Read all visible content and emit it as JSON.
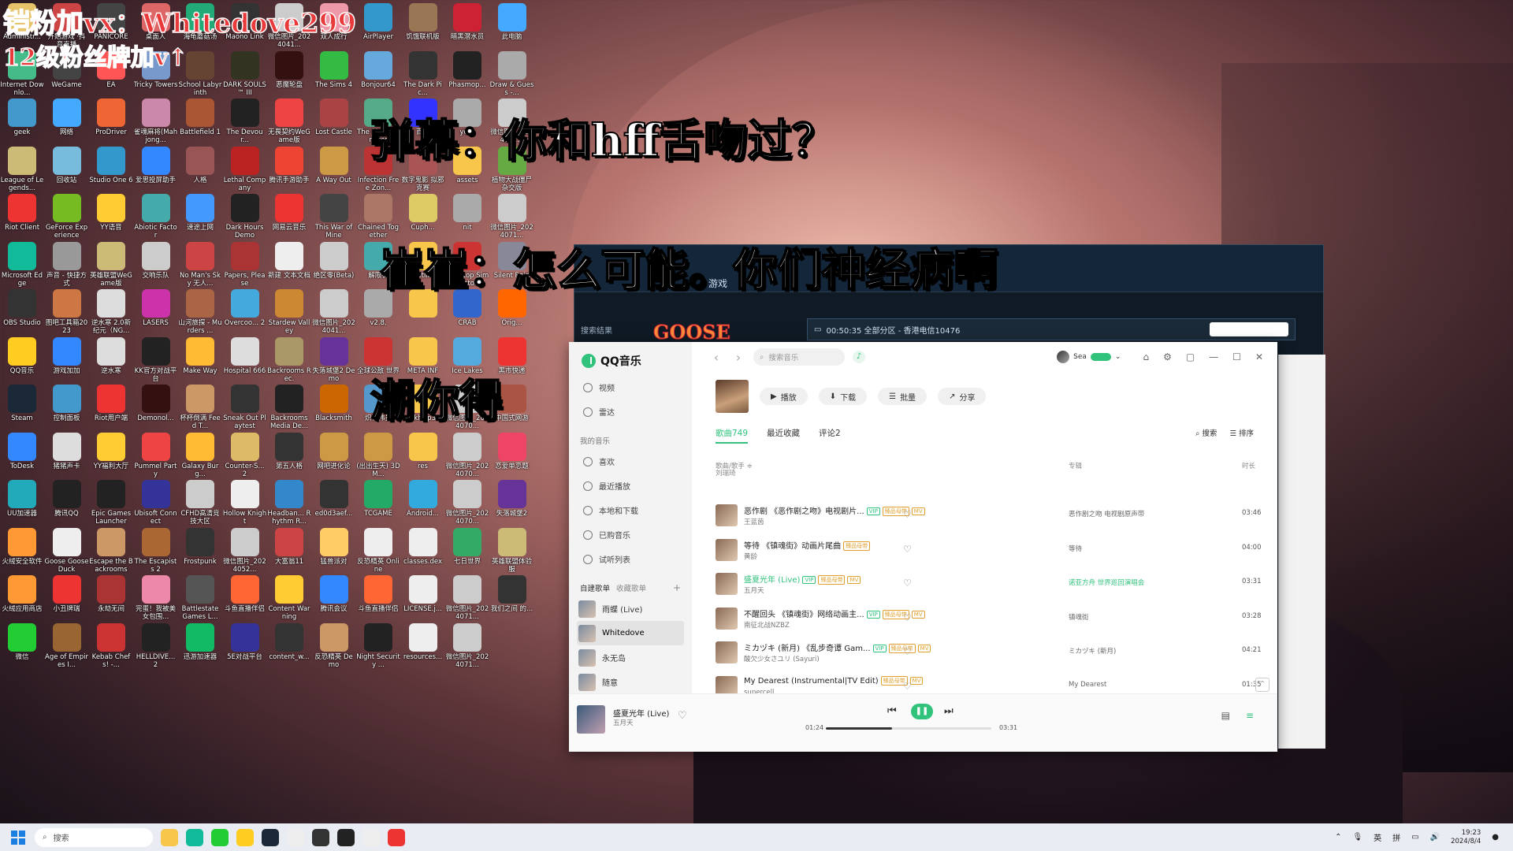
{
  "overlay": {
    "top_line1": "铠粉加vx：Whitedove299",
    "top_line2": "12级粉丝牌加v↑",
    "line_danmaku": "弹幕：你和hff舌吻过？",
    "line_reply": "崔崔：怎么可能。你们神经病啊",
    "line_tease": "潮你得"
  },
  "desktop_icons": [
    {
      "label": "Administr...",
      "color": "#e6c36a"
    },
    {
      "label": "开始游戏 ·抖音直播",
      "color": "#c44"
    },
    {
      "label": "PANICORE",
      "color": "#444"
    },
    {
      "label": "桌面人",
      "color": "#d66"
    },
    {
      "label": "海龟蘑菇汤",
      "color": "#2a7"
    },
    {
      "label": "Maono Link",
      "color": "#333"
    },
    {
      "label": "微信图片_2024041...",
      "color": "#ccc"
    },
    {
      "label": "双人成行",
      "color": "#e9a"
    },
    {
      "label": "AirPlayer",
      "color": "#39c"
    },
    {
      "label": "饥饿联机版",
      "color": "#975"
    },
    {
      "label": "暗黑潜水员",
      "color": "#c23"
    },
    {
      "label": "此电脑",
      "color": "#4af"
    },
    {
      "label": "Internet Downlo...",
      "color": "#4b8"
    },
    {
      "label": "WeGame",
      "color": "#444"
    },
    {
      "label": "EA",
      "color": "#f55"
    },
    {
      "label": "Tricky Towers",
      "color": "#79c"
    },
    {
      "label": "School Labyrinth",
      "color": "#643"
    },
    {
      "label": "DARK SOULS™ III",
      "color": "#332"
    },
    {
      "label": "恶魔轮盘",
      "color": "#311"
    },
    {
      "label": "The Sims 4",
      "color": "#3b4"
    },
    {
      "label": "Bonjour64",
      "color": "#6ad"
    },
    {
      "label": "The Dark Pic...",
      "color": "#333"
    },
    {
      "label": "Phasmop...",
      "color": "#222"
    },
    {
      "label": "Draw & Guess -...",
      "color": "#aaa"
    },
    {
      "label": "geek",
      "color": "#49c"
    },
    {
      "label": "网络",
      "color": "#4af"
    },
    {
      "label": "ProDriver",
      "color": "#e63"
    },
    {
      "label": "雀魂麻将(Mahjong...",
      "color": "#c8a"
    },
    {
      "label": "Battlefield 1",
      "color": "#a53"
    },
    {
      "label": "The Devour...",
      "color": "#222"
    },
    {
      "label": "无畏契约WeGame版",
      "color": "#e44"
    },
    {
      "label": "Lost Castle",
      "color": "#a44"
    },
    {
      "label": "The Planet Crafter",
      "color": "#5a8"
    },
    {
      "label": "百度",
      "color": "#33f"
    },
    {
      "label": "your",
      "color": "#aaa"
    },
    {
      "label": "微信图片_2024071...",
      "color": "#ccc"
    },
    {
      "label": "League of Legends...",
      "color": "#cb7"
    },
    {
      "label": "回收站",
      "color": "#7bd"
    },
    {
      "label": "Studio One 6",
      "color": "#39c"
    },
    {
      "label": "爱思投屏助手",
      "color": "#38f"
    },
    {
      "label": "人格",
      "color": "#955"
    },
    {
      "label": "Lethal Company",
      "color": "#b22"
    },
    {
      "label": "腾讯手游助手",
      "color": "#e43"
    },
    {
      "label": "A Way Out",
      "color": "#c94"
    },
    {
      "label": "Infection Free Zon...",
      "color": "#b33"
    },
    {
      "label": "数字鬼影 拟邪克赛",
      "color": "#a55"
    },
    {
      "label": "assets",
      "color": "#f7c64a"
    },
    {
      "label": "植物大战僵尸杂交版",
      "color": "#6a4"
    },
    {
      "label": "Riot Client",
      "color": "#e33"
    },
    {
      "label": "GeForce Experience",
      "color": "#7b2"
    },
    {
      "label": "YY语音",
      "color": "#fc3"
    },
    {
      "label": "Abiotic Factor",
      "color": "#4aa"
    },
    {
      "label": "速途上网",
      "color": "#49f"
    },
    {
      "label": "Dark Hours Demo",
      "color": "#222"
    },
    {
      "label": "网易云音乐",
      "color": "#e33"
    },
    {
      "label": "This War of Mine",
      "color": "#444"
    },
    {
      "label": "Chained Together",
      "color": "#a76"
    },
    {
      "label": "Cuph...",
      "color": "#dc6"
    },
    {
      "label": "nit",
      "color": "#aaa"
    },
    {
      "label": "微信图片_2024071...",
      "color": "#ccc"
    },
    {
      "label": "Microsoft Edge",
      "color": "#1b9"
    },
    {
      "label": "声音 - 快捷方式",
      "color": "#999"
    },
    {
      "label": "英雄联盟WeGame版",
      "color": "#cb7"
    },
    {
      "label": "交响乐队",
      "color": "#ccc"
    },
    {
      "label": "No Man's Sky 无人...",
      "color": "#c44"
    },
    {
      "label": "Papers, Please",
      "color": "#a33"
    },
    {
      "label": "新建 文本文档",
      "color": "#eee"
    },
    {
      "label": "绝区零(Beta)",
      "color": "#ccc"
    },
    {
      "label": "解限机",
      "color": "#4aa"
    },
    {
      "label": "kotlin",
      "color": "#f7c64a"
    },
    {
      "label": "Tabletop Simulator",
      "color": "#c33"
    },
    {
      "label": "Silent Rain",
      "color": "#889"
    },
    {
      "label": "OBS Studio",
      "color": "#333"
    },
    {
      "label": "图吧工具箱2023",
      "color": "#c74"
    },
    {
      "label": "逆水寒 2.0新纪元（NG...",
      "color": "#ddd"
    },
    {
      "label": "LASERS",
      "color": "#c3a"
    },
    {
      "label": "山河旅探 - Murders ...",
      "color": "#a64"
    },
    {
      "label": "Overcoo... 2",
      "color": "#4ad"
    },
    {
      "label": "Stardew Valley",
      "color": "#c83"
    },
    {
      "label": "微信图片_2024041...",
      "color": "#ccc"
    },
    {
      "label": "v2.8.",
      "color": "#aaa"
    },
    {
      "label": "",
      "color": "#f7c64a"
    },
    {
      "label": "CRAB",
      "color": "#36c"
    },
    {
      "label": "Orig...",
      "color": "#f60"
    },
    {
      "label": "QQ音乐",
      "color": "#fc2"
    },
    {
      "label": "游戏加加",
      "color": "#38f"
    },
    {
      "label": "逆水寒",
      "color": "#ddd"
    },
    {
      "label": "KK官方对战平台",
      "color": "#222"
    },
    {
      "label": "Make Way",
      "color": "#fb3"
    },
    {
      "label": "Hospital 666",
      "color": "#ddd"
    },
    {
      "label": "Backrooms Rec.",
      "color": "#a96"
    },
    {
      "label": "失落城堡2 Demo",
      "color": "#639"
    },
    {
      "label": "全球公敌 世界",
      "color": "#c33"
    },
    {
      "label": "META INF",
      "color": "#f7c64a"
    },
    {
      "label": "Ice Lakes",
      "color": "#5ad"
    },
    {
      "label": "黑市快递",
      "color": "#e33"
    },
    {
      "label": "Steam",
      "color": "#1b2838"
    },
    {
      "label": "控制面板",
      "color": "#49c"
    },
    {
      "label": "Riot用户端",
      "color": "#e33"
    },
    {
      "label": "Demonol...",
      "color": "#311"
    },
    {
      "label": "杯杯倒满 Feed T...",
      "color": "#c96"
    },
    {
      "label": "Sneak Out Playtest",
      "color": "#333"
    },
    {
      "label": "Backrooms Media De...",
      "color": "#222"
    },
    {
      "label": "Blacksmith",
      "color": "#c60"
    },
    {
      "label": "炽石伟员",
      "color": "#59c"
    },
    {
      "label": "okhttp3",
      "color": "#f7c64a"
    },
    {
      "label": "微信图片_2024070...",
      "color": "#ccc"
    },
    {
      "label": "中国式网游",
      "color": "#a54"
    },
    {
      "label": "ToDesk",
      "color": "#38f"
    },
    {
      "label": "猪猪声卡",
      "color": "#ddd"
    },
    {
      "label": "YY福利大厅",
      "color": "#fc3"
    },
    {
      "label": "Pummel Party",
      "color": "#e44"
    },
    {
      "label": "Galaxy Burg...",
      "color": "#fb3"
    },
    {
      "label": "Counter-S... 2",
      "color": "#db6"
    },
    {
      "label": "第五人格",
      "color": "#333"
    },
    {
      "label": "网吧进化论",
      "color": "#c94"
    },
    {
      "label": "(出出生天) 3DM...",
      "color": "#c94"
    },
    {
      "label": "res",
      "color": "#f7c64a"
    },
    {
      "label": "微信图片_2024070...",
      "color": "#ccc"
    },
    {
      "label": "恋爱单恋题",
      "color": "#e46"
    },
    {
      "label": "UU加速器",
      "color": "#2ab"
    },
    {
      "label": "腾讯QQ",
      "color": "#222"
    },
    {
      "label": "Epic Games Launcher",
      "color": "#222"
    },
    {
      "label": "Ubisoft Connect",
      "color": "#339"
    },
    {
      "label": "CFHD高清竞技大区",
      "color": "#ccc"
    },
    {
      "label": "Hollow Knight",
      "color": "#eee"
    },
    {
      "label": "Headban... Rhythm R...",
      "color": "#38c"
    },
    {
      "label": "ed0d3aef...",
      "color": "#333"
    },
    {
      "label": "TCGAME",
      "color": "#2a6"
    },
    {
      "label": "Android...",
      "color": "#3ad"
    },
    {
      "label": "微信图片_2024070...",
      "color": "#ccc"
    },
    {
      "label": "失落城堡2",
      "color": "#639"
    },
    {
      "label": "火绒安全软件",
      "color": "#f93"
    },
    {
      "label": "Goose Goose Duck",
      "color": "#eee"
    },
    {
      "label": "Escape the Backrooms",
      "color": "#c96"
    },
    {
      "label": "The Escapists 2",
      "color": "#a63"
    },
    {
      "label": "Frostpunk",
      "color": "#333"
    },
    {
      "label": "微信图片_2024052...",
      "color": "#ccc"
    },
    {
      "label": "大富翁11",
      "color": "#c44"
    },
    {
      "label": "猛兽派对",
      "color": "#fc6"
    },
    {
      "label": "反恐精英 Online",
      "color": "#eee"
    },
    {
      "label": "classes.dex",
      "color": "#eee"
    },
    {
      "label": "七日世界",
      "color": "#3a6"
    },
    {
      "label": "英雄联盟体验服",
      "color": "#cb7"
    },
    {
      "label": "火绒应用商店",
      "color": "#f93"
    },
    {
      "label": "小丑牌瑞",
      "color": "#e33"
    },
    {
      "label": "永劫无间",
      "color": "#a33"
    },
    {
      "label": "完蛋！我被美女包围...",
      "color": "#e8a"
    },
    {
      "label": "Battlestate Games L...",
      "color": "#555"
    },
    {
      "label": "斗鱼直播伴侣",
      "color": "#f63"
    },
    {
      "label": "Content Warning",
      "color": "#fc3"
    },
    {
      "label": "腾讯会议",
      "color": "#38f"
    },
    {
      "label": "斗鱼直播伴侣",
      "color": "#f63"
    },
    {
      "label": "LICENSE.j...",
      "color": "#eee"
    },
    {
      "label": "微信图片_2024071...",
      "color": "#ccc"
    },
    {
      "label": "我们之间 的...",
      "color": "#333"
    },
    {
      "label": "微信",
      "color": "#2c3"
    },
    {
      "label": "Age of Empires I...",
      "color": "#963"
    },
    {
      "label": "Kebab Chefs! -...",
      "color": "#c33"
    },
    {
      "label": "HELLDIVE... 2",
      "color": "#222"
    },
    {
      "label": "迅游加速器",
      "color": "#1b6"
    },
    {
      "label": "5E对战平台",
      "color": "#339"
    },
    {
      "label": "content_w...",
      "color": "#333"
    },
    {
      "label": "反恐精英 Demo",
      "color": "#c96"
    },
    {
      "label": "Night Security ...",
      "color": "#222"
    },
    {
      "label": "resources...",
      "color": "#eee"
    },
    {
      "label": "微信图片_2024071...",
      "color": "#ccc"
    }
  ],
  "bg_window": {
    "title_left": "游戏",
    "goose_text": "GOOSE",
    "search_label": "搜索结果",
    "popup_text": "00:50:35  全部分区 - 香港电信10476"
  },
  "qq": {
    "app_name": "QQ音乐",
    "sidebar_items": [
      "视频",
      "雷达"
    ],
    "my_music_label": "我的音乐",
    "my_music_items": [
      "喜欢",
      "最近播放",
      "本地和下载",
      "已购音乐",
      "试听列表"
    ],
    "playlist_tab_created": "自建歌单",
    "playlist_tab_collected": "收藏歌单",
    "playlists": [
      "雨蝶 (Live)",
      "Whitedove",
      "永无岛",
      "随意"
    ],
    "search_placeholder": "搜索音乐",
    "user_name": "Sea",
    "btn_play": "播放",
    "btn_download": "下载",
    "btn_batch": "批量",
    "btn_share": "分享",
    "tabs": [
      "歌曲749",
      "最近收藏",
      "评论2"
    ],
    "tab_search": "搜索",
    "tab_sort": "排序",
    "col_song": "歌曲/歌手 ≑",
    "col_album": "专辑",
    "col_duration": "时长",
    "partial_artist": "刘瑞琦",
    "songs": [
      {
        "title": "恶作剧 《恶作剧之吻》电视剧片...",
        "artist": "王蓝茵",
        "album": "恶作剧之吻 电视剧原声带",
        "duration": "03:46",
        "tags": [
          "VIP",
          "臻品母带",
          "MV"
        ],
        "playing": false
      },
      {
        "title": "等待 《镇魂街》动画片尾曲",
        "artist": "黄龄",
        "album": "等待",
        "duration": "04:00",
        "tags": [
          "臻品母带"
        ],
        "playing": false
      },
      {
        "title": "盛夏光年 (Live)",
        "artist": "五月天",
        "album": "诺亚方舟 世界巡回演唱会",
        "duration": "03:31",
        "tags": [
          "VIP",
          "臻品母带",
          "MV"
        ],
        "playing": true
      },
      {
        "title": "不醒回头 《镇魂街》网络动画主...",
        "artist": "南征北战NZBZ",
        "album": "镇魂街",
        "duration": "03:28",
        "tags": [
          "VIP",
          "臻品母带",
          "MV"
        ],
        "playing": false
      },
      {
        "title": "ミカヅキ (新月) 《乱步奇谭 Gam...",
        "artist": "酸欠少女さユリ (Sayuri)",
        "album": "ミカヅキ (新月)",
        "duration": "04:21",
        "tags": [
          "VIP",
          "臻品母带",
          "MV"
        ],
        "playing": false
      },
      {
        "title": "My Dearest (Instrumental|TV Edit)",
        "artist": "supercell",
        "album": "My Dearest",
        "duration": "01:35",
        "tags": [
          "臻品母带",
          "MV"
        ],
        "playing": false
      }
    ],
    "player": {
      "title": "盛夏光年 (Live)",
      "artist": "五月天",
      "current": "01:24",
      "total": "03:31",
      "progress": 0.4
    }
  },
  "taskbar": {
    "search_placeholder": "搜索",
    "ime1": "英",
    "ime2": "拼",
    "time": "19:23",
    "date": "2024/8/4"
  }
}
